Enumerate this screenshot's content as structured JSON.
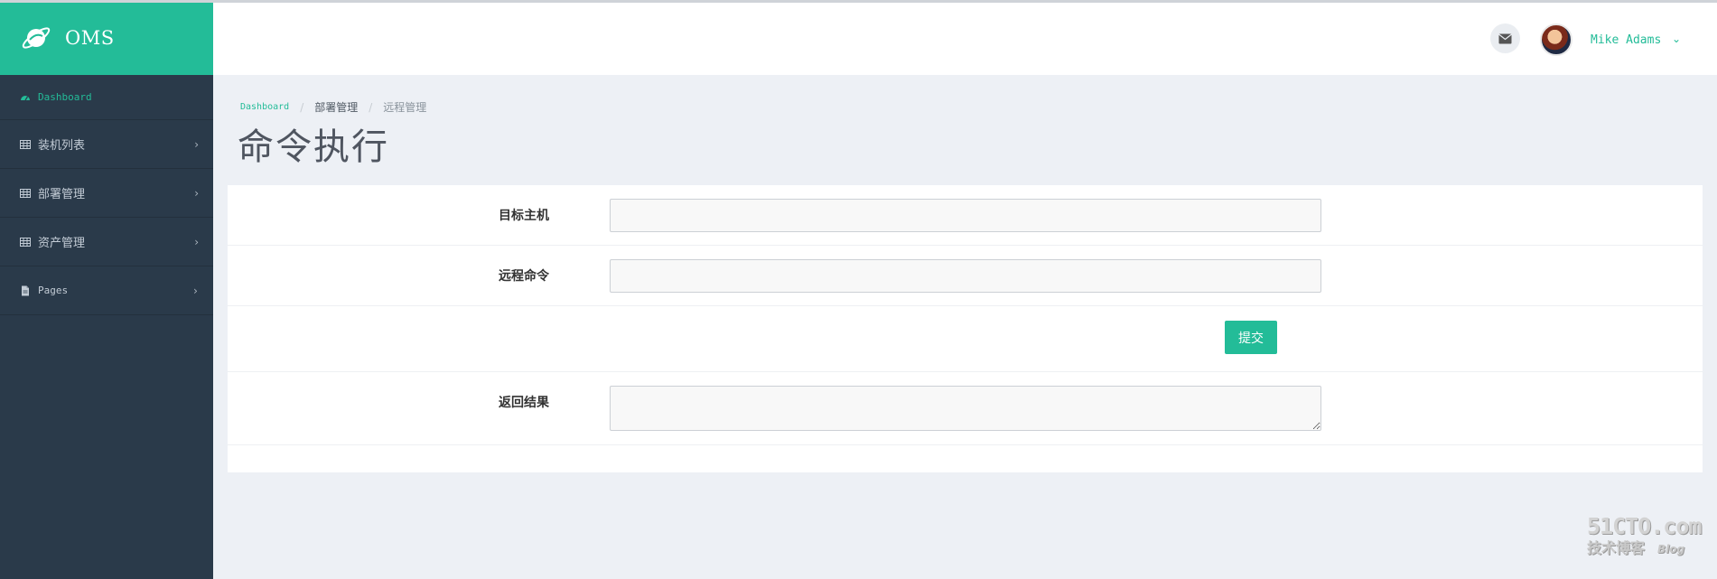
{
  "app": {
    "brand": "OMS",
    "accent_color": "#23bc98",
    "sidebar_bg": "#2a3a4a"
  },
  "sidebar": {
    "items": [
      {
        "label": "Dashboard",
        "icon": "dashboard-icon",
        "has_chevron": false
      },
      {
        "label": "装机列表",
        "icon": "table-icon",
        "has_chevron": true
      },
      {
        "label": "部署管理",
        "icon": "table-icon",
        "has_chevron": true
      },
      {
        "label": "资产管理",
        "icon": "table-icon",
        "has_chevron": true
      },
      {
        "label": "Pages",
        "icon": "file-icon",
        "has_chevron": true
      }
    ],
    "chevron": "›"
  },
  "header": {
    "mail_icon": "envelope-icon",
    "user_name": "Mike Adams",
    "user_chevron": "⌄"
  },
  "breadcrumb": {
    "items": [
      "Dashboard",
      "部署管理",
      "远程管理"
    ],
    "separator": "/"
  },
  "page": {
    "title": "命令执行"
  },
  "form": {
    "target_label": "目标主机",
    "target_value": "",
    "command_label": "远程命令",
    "command_value": "",
    "submit_label": "提交",
    "result_label": "返回结果",
    "result_value": ""
  },
  "watermark": {
    "top": "51CTO.com",
    "bottom": "技术博客",
    "blog": "Blog"
  }
}
